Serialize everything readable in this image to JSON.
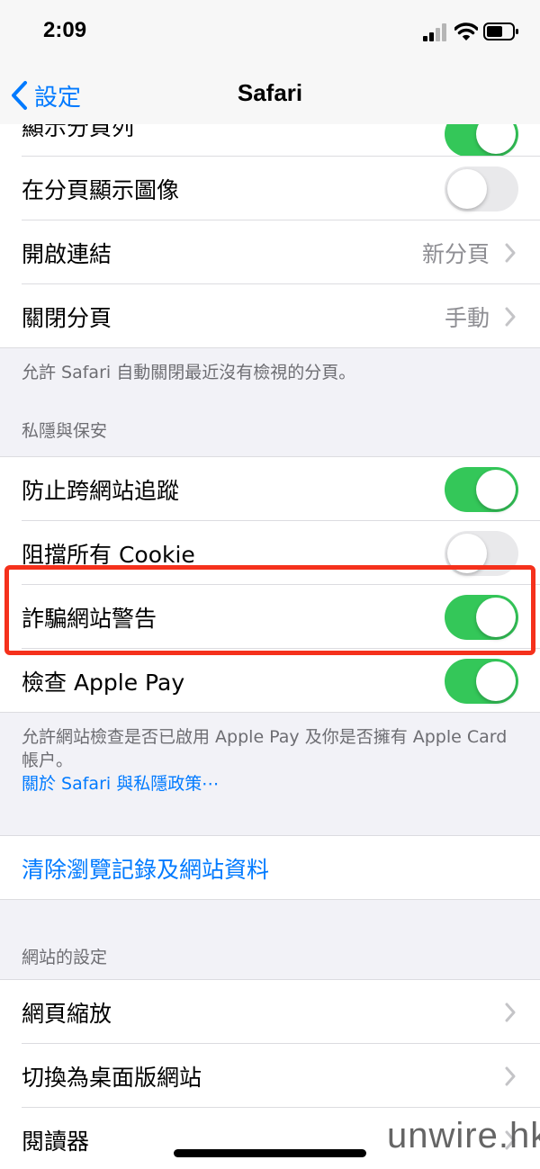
{
  "status_bar": {
    "time": "2:09"
  },
  "nav": {
    "back_label": "設定",
    "title": "Safari"
  },
  "tabs_section": {
    "items": [
      {
        "label": "顯示分頁列",
        "control": "toggle",
        "on": true
      },
      {
        "label": "在分頁顯示圖像",
        "control": "toggle",
        "on": false
      },
      {
        "label": "開啟連結",
        "control": "disclosure",
        "value": "新分頁"
      },
      {
        "label": "關閉分頁",
        "control": "disclosure",
        "value": "手動"
      }
    ],
    "footer": "允許 Safari 自動關閉最近沒有檢視的分頁。"
  },
  "privacy_section": {
    "header": "私隱與保安",
    "items": [
      {
        "label": "防止跨網站追蹤",
        "control": "toggle",
        "on": true
      },
      {
        "label": "阻擋所有 Cookie",
        "control": "toggle",
        "on": false
      },
      {
        "label": "詐騙網站警告",
        "control": "toggle",
        "on": true
      },
      {
        "label": "檢查 Apple Pay",
        "control": "toggle",
        "on": true
      }
    ],
    "footer": "允許網站檢查是否已啟用 Apple Pay 及你是否擁有 Apple Card 帳户。",
    "footer_link": "關於 Safari 與私隱政策⋯"
  },
  "clear_history": {
    "label": "清除瀏覽記錄及網站資料"
  },
  "website_settings_section": {
    "header": "網站的設定",
    "items": [
      {
        "label": "網頁縮放"
      },
      {
        "label": "切換為桌面版網站"
      },
      {
        "label": "閱讀器"
      }
    ]
  },
  "watermark": "unwire.hk",
  "colors": {
    "accent": "#007aff",
    "toggle_on": "#34c759",
    "toggle_off": "#e9e9eb",
    "highlight": "#f5311c",
    "background": "#f2f2f7"
  },
  "icons": {
    "back": "chevron-left-icon",
    "disclosure": "chevron-right-icon",
    "signal": "cellular-signal-icon",
    "wifi": "wifi-icon",
    "battery": "battery-icon"
  }
}
